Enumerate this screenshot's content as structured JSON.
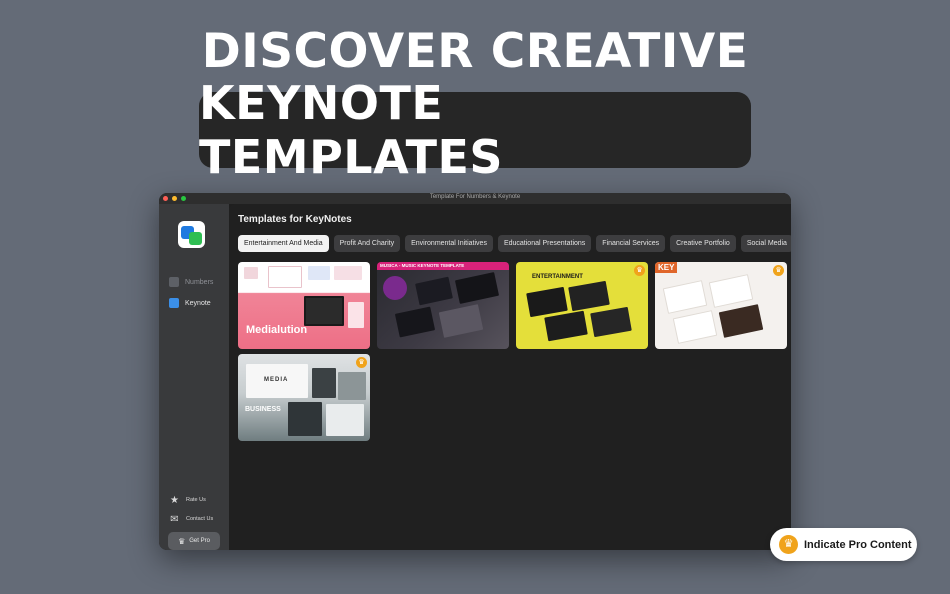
{
  "hero": {
    "line1": "DISCOVER CREATIVE",
    "line2": "KEYNOTE TEMPLATES"
  },
  "window": {
    "title": "Template For Numbers & Keynote"
  },
  "sidebar": {
    "items": [
      {
        "label": "Numbers",
        "icon": "numbers-chart-icon"
      },
      {
        "label": "Keynote",
        "icon": "keynote-podium-icon"
      }
    ],
    "rate_us": "Rate Us",
    "contact_us": "Contact Us",
    "get_pro": "Get Pro"
  },
  "main": {
    "title": "Templates for KeyNotes",
    "tabs": [
      {
        "label": "Entertainment And Media",
        "active": true
      },
      {
        "label": "Profit And Charity"
      },
      {
        "label": "Environmental Initiatives"
      },
      {
        "label": "Educational Presentations"
      },
      {
        "label": "Financial Services"
      },
      {
        "label": "Creative Portfolio"
      },
      {
        "label": "Social Media"
      }
    ],
    "templates": [
      {
        "label": "Medialution",
        "pro": false
      },
      {
        "label": "MUSICA - MUSIC KEYNOTE TEMPLATE",
        "pro": false
      },
      {
        "label": "ENTERTAINMENT",
        "pro": true
      },
      {
        "label": "KEY",
        "pro": true
      },
      {
        "label": "MEDIA",
        "sublabel": "BUSINESS",
        "pro": true
      }
    ]
  },
  "badge": {
    "label": "Indicate Pro Content"
  },
  "colors": {
    "background": "#646b77",
    "accent_pro": "#f0a31b",
    "window_bg": "#202020",
    "sidebar_bg": "#393a3c"
  }
}
